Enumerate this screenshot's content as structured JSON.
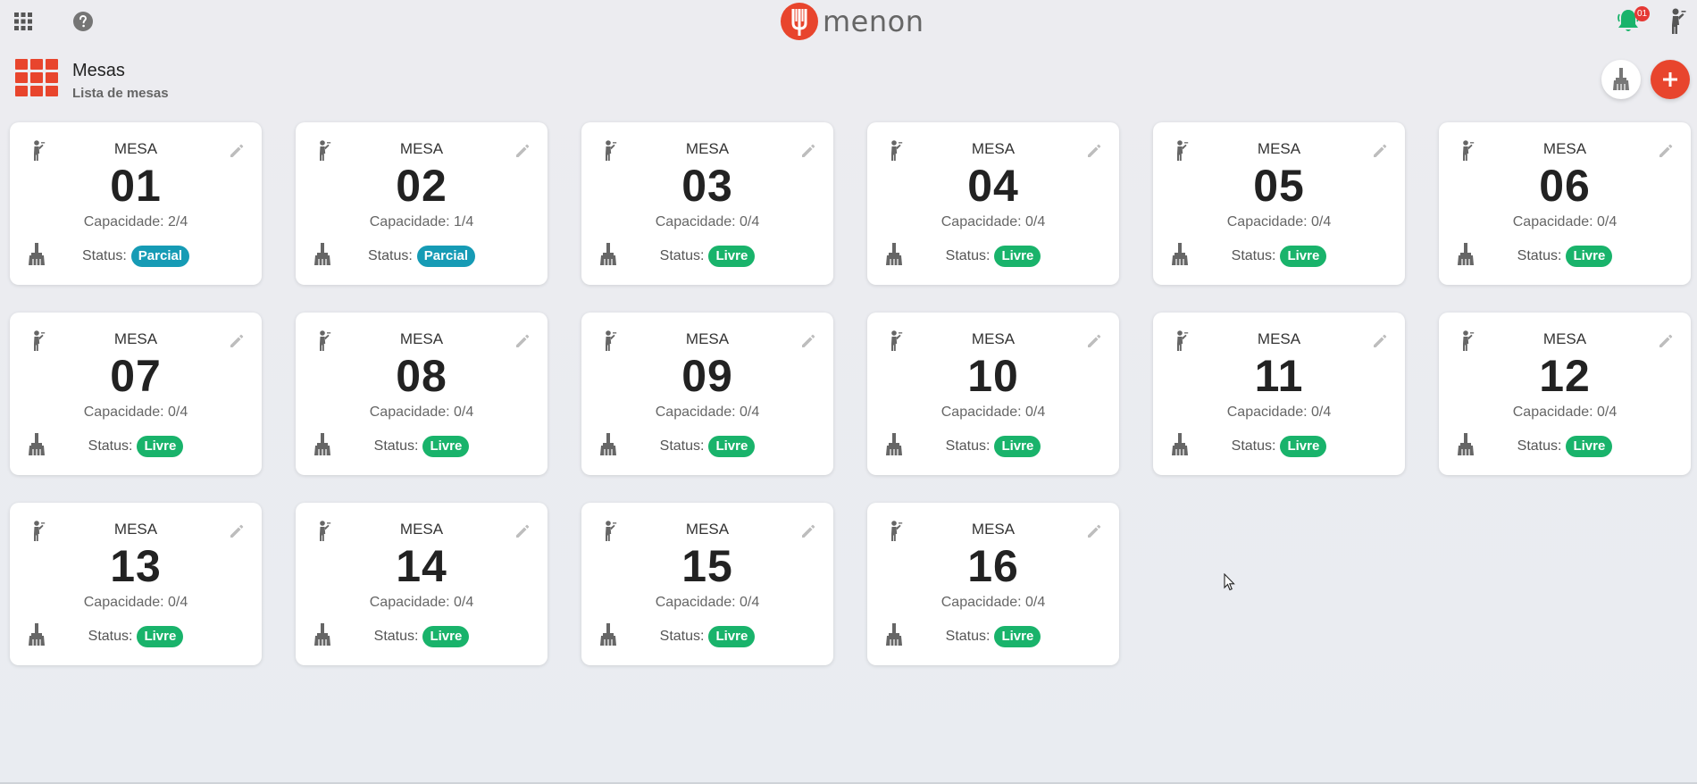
{
  "app": {
    "logo_text": "menon",
    "notification_count": "01",
    "brand_color": "#e8452d"
  },
  "header": {
    "title": "Mesas",
    "subtitle": "Lista de mesas"
  },
  "labels": {
    "mesa": "MESA",
    "status": "Status:"
  },
  "status_colors": {
    "Parcial": "#169bb5",
    "Livre": "#19b36b"
  },
  "tables": [
    {
      "number": "01",
      "capacity": "Capacidade: 2/4",
      "status": "Parcial",
      "status_key": "partial"
    },
    {
      "number": "02",
      "capacity": "Capacidade: 1/4",
      "status": "Parcial",
      "status_key": "partial"
    },
    {
      "number": "03",
      "capacity": "Capacidade: 0/4",
      "status": "Livre",
      "status_key": "free"
    },
    {
      "number": "04",
      "capacity": "Capacidade: 0/4",
      "status": "Livre",
      "status_key": "free"
    },
    {
      "number": "05",
      "capacity": "Capacidade: 0/4",
      "status": "Livre",
      "status_key": "free"
    },
    {
      "number": "06",
      "capacity": "Capacidade: 0/4",
      "status": "Livre",
      "status_key": "free"
    },
    {
      "number": "07",
      "capacity": "Capacidade: 0/4",
      "status": "Livre",
      "status_key": "free"
    },
    {
      "number": "08",
      "capacity": "Capacidade: 0/4",
      "status": "Livre",
      "status_key": "free"
    },
    {
      "number": "09",
      "capacity": "Capacidade: 0/4",
      "status": "Livre",
      "status_key": "free"
    },
    {
      "number": "10",
      "capacity": "Capacidade: 0/4",
      "status": "Livre",
      "status_key": "free"
    },
    {
      "number": "11",
      "capacity": "Capacidade: 0/4",
      "status": "Livre",
      "status_key": "free"
    },
    {
      "number": "12",
      "capacity": "Capacidade: 0/4",
      "status": "Livre",
      "status_key": "free"
    },
    {
      "number": "13",
      "capacity": "Capacidade: 0/4",
      "status": "Livre",
      "status_key": "free"
    },
    {
      "number": "14",
      "capacity": "Capacidade: 0/4",
      "status": "Livre",
      "status_key": "free"
    },
    {
      "number": "15",
      "capacity": "Capacidade: 0/4",
      "status": "Livre",
      "status_key": "free"
    },
    {
      "number": "16",
      "capacity": "Capacidade: 0/4",
      "status": "Livre",
      "status_key": "free"
    }
  ]
}
